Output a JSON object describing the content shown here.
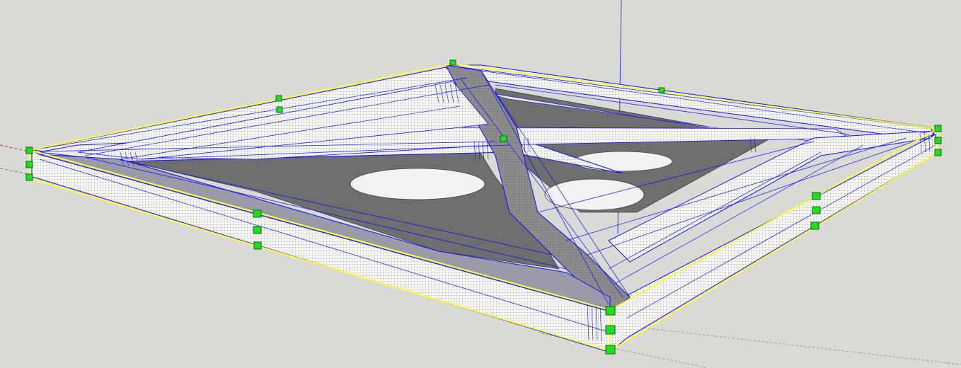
{
  "viewport": {
    "background": "#d9d9d5",
    "tool": "scale-tool",
    "selection": "selected-component"
  },
  "colors": {
    "selection_edge": "#1010ff",
    "bounding_box": "#ffff33",
    "grip": "#22dd22",
    "grip_border": "#0a6a0a",
    "axis_blue": "#3a3aff",
    "axis_red": "#c04040",
    "axis_green": "#40a040",
    "face_white": "#f4f4f4",
    "face_shadow": "#8a8a8a",
    "face_dark": "#6b6b6b"
  },
  "icons": {
    "grip": "square-grip-icon"
  }
}
